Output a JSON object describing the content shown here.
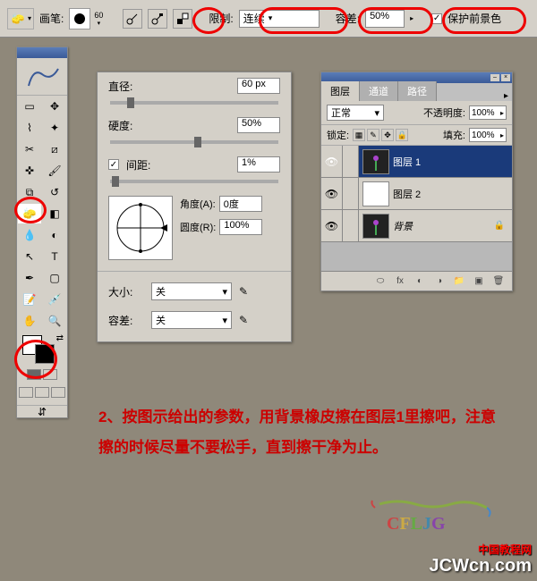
{
  "topbar": {
    "brush_label": "画笔:",
    "brush_size": "60",
    "limit_label": "限制:",
    "limit_value": "连续",
    "tolerance_label": "容差:",
    "tolerance_value": "50%",
    "protect_fg": "保护前景色"
  },
  "brush_panel": {
    "diameter_label": "直径:",
    "diameter_value": "60 px",
    "hardness_label": "硬度:",
    "hardness_value": "50%",
    "spacing_label": "间距:",
    "spacing_value": "1%",
    "angle_label": "角度(A):",
    "angle_value": "0度",
    "round_label": "圆度(R):",
    "round_value": "100%",
    "size_label": "大小:",
    "size_value": "关",
    "tol_label": "容差:",
    "tol_value": "关"
  },
  "layers": {
    "tab1": "图层",
    "tab2": "通道",
    "tab3": "路径",
    "blend_mode": "正常",
    "opacity_label": "不透明度:",
    "opacity_value": "100%",
    "lock_label": "锁定:",
    "fill_label": "填充:",
    "fill_value": "100%",
    "layer1": "图层 1",
    "layer2": "图层 2",
    "bg_layer": "背景"
  },
  "instruction_text": "2、按图示给出的参数，用背景橡皮擦在图层1里擦吧，注意擦的时候尽量不要松手，直到擦干净为止。",
  "watermark": {
    "top": "中国教程网",
    "bottom": "JCWcn.com"
  },
  "logo": "CFLJG"
}
